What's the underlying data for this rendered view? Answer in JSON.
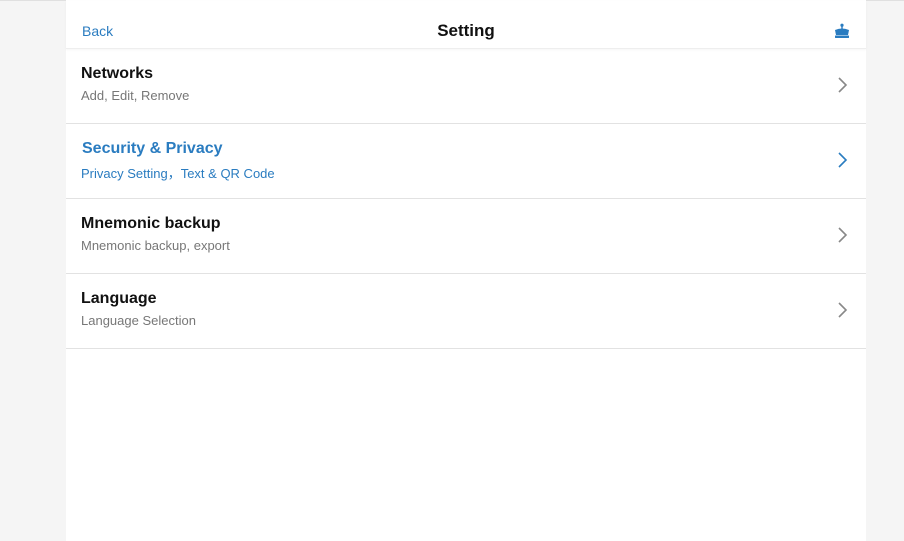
{
  "header": {
    "back_label": "Back",
    "title": "Setting",
    "crown_icon": "crown-icon"
  },
  "settings": {
    "items": [
      {
        "label": "Networks",
        "sub": "Add, Edit, Remove"
      },
      {
        "label": "Security & Privacy",
        "sub": "Privacy Setting，Text & QR Code"
      },
      {
        "label": "Mnemonic backup",
        "sub": "Mnemonic backup, export"
      },
      {
        "label": "Language",
        "sub": "Language Selection"
      }
    ]
  },
  "colors": {
    "accent": "#2a7cc0",
    "text": "#111111",
    "muted": "#777777",
    "background": "#f5f5f5"
  }
}
